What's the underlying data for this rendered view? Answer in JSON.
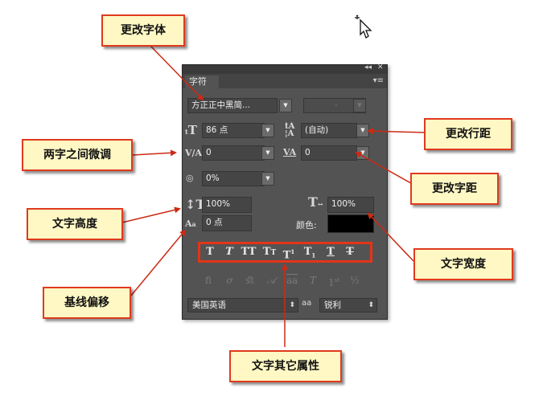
{
  "panel": {
    "tab_label": "字符",
    "collapse_icon": "◂◂",
    "close_icon": "✕",
    "menu_icon": "▾≡",
    "font_family": "方正正中黑简...",
    "font_style": "-",
    "font_size": "86 点",
    "leading": "(自动)",
    "kerning": "0",
    "tracking": "0",
    "tsume": "0%",
    "vertical_scale": "100%",
    "horizontal_scale": "100%",
    "baseline_shift": "0 点",
    "color_label": "颜色:",
    "color_value": "#000000",
    "language": "美国英语",
    "antialias_icon": "aa",
    "antialias": "锐利"
  },
  "annotations": {
    "change_font": "更改字体",
    "change_leading": "更改行距",
    "kerning_two_chars": "两字之间微调",
    "change_tracking": "更改字距",
    "text_height": "文字高度",
    "text_width": "文字宽度",
    "baseline_shift": "基线偏移",
    "other_attributes": "文字其它属性"
  },
  "colors": {
    "panel_bg": "#535353",
    "callout_bg": "#fff8c4",
    "callout_border": "#e03a1e",
    "highlight": "#e53418",
    "arrow": "#cc2a14"
  }
}
